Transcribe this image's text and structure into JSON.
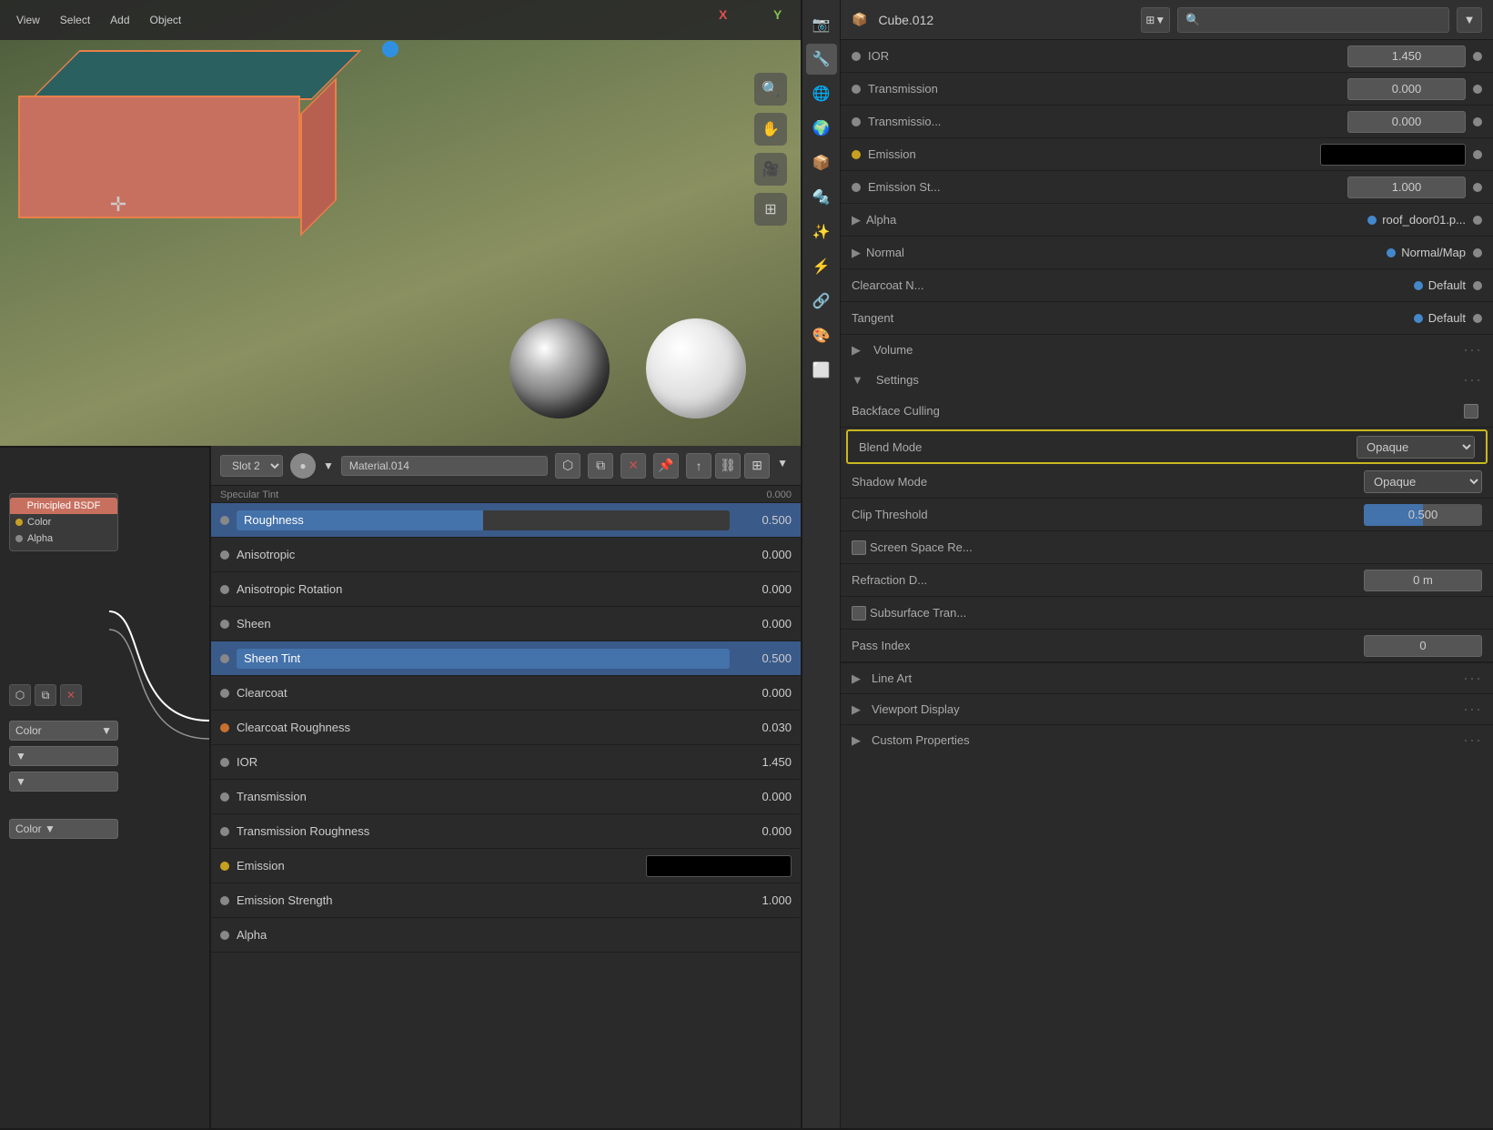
{
  "viewport": {
    "axis_x": "X",
    "axis_y": "Y",
    "object_name": "Cube.012"
  },
  "props_toolbar": {
    "slot_label": "Slot 2",
    "material_name": "Material.014"
  },
  "properties": {
    "specular_tint_label": "Specular Tint",
    "specular_tint_value": "0.000",
    "roughness_label": "Roughness",
    "roughness_value": "0.500",
    "anisotropic_label": "Anisotropic",
    "anisotropic_value": "0.000",
    "anisotropic_rotation_label": "Anisotropic Rotation",
    "anisotropic_rotation_value": "0.000",
    "sheen_label": "Sheen",
    "sheen_value": "0.000",
    "sheen_tint_label": "Sheen Tint",
    "sheen_tint_value": "0.500",
    "clearcoat_label": "Clearcoat",
    "clearcoat_value": "0.000",
    "clearcoat_roughness_label": "Clearcoat Roughness",
    "clearcoat_roughness_value": "0.030",
    "ior_label": "IOR",
    "ior_value": "1.450",
    "transmission_label": "Transmission",
    "transmission_value": "0.000",
    "transmission_roughness_label": "Transmission Roughness",
    "transmission_roughness_value": "0.000",
    "emission_label": "Emission",
    "emission_strength_label": "Emission Strength",
    "emission_strength_value": "1.000",
    "alpha_label": "Alpha"
  },
  "right_panel": {
    "title": "Cube.012",
    "ior_label": "IOR",
    "ior_value": "1.450",
    "transmission_label": "Transmission",
    "transmission_value": "0.000",
    "transmission_roughness_label": "Transmissio...",
    "transmission_roughness_value": "0.000",
    "emission_label": "Emission",
    "emission_strength_label": "Emission St...",
    "emission_strength_value": "1.000",
    "alpha_label": "Alpha",
    "alpha_value": "roof_door01.p...",
    "normal_label": "Normal",
    "normal_value": "Normal/Map",
    "clearcoat_n_label": "Clearcoat N...",
    "clearcoat_n_value": "Default",
    "tangent_label": "Tangent",
    "tangent_value": "Default",
    "volume_label": "Volume",
    "settings_label": "Settings",
    "backface_culling_label": "Backface Culling",
    "blend_mode_label": "Blend Mode",
    "blend_mode_value": "Opaque",
    "shadow_mode_label": "Shadow Mode",
    "shadow_mode_value": "Opaque",
    "clip_threshold_label": "Clip Threshold",
    "clip_threshold_value": "0.500",
    "screen_space_label": "Screen Space Re...",
    "refraction_d_label": "Refraction D...",
    "refraction_d_value": "0 m",
    "subsurface_tran_label": "Subsurface Tran...",
    "pass_index_label": "Pass Index",
    "pass_index_value": "0",
    "line_art_label": "Line Art",
    "viewport_display_label": "Viewport Display",
    "custom_properties_label": "Custom Properties"
  }
}
